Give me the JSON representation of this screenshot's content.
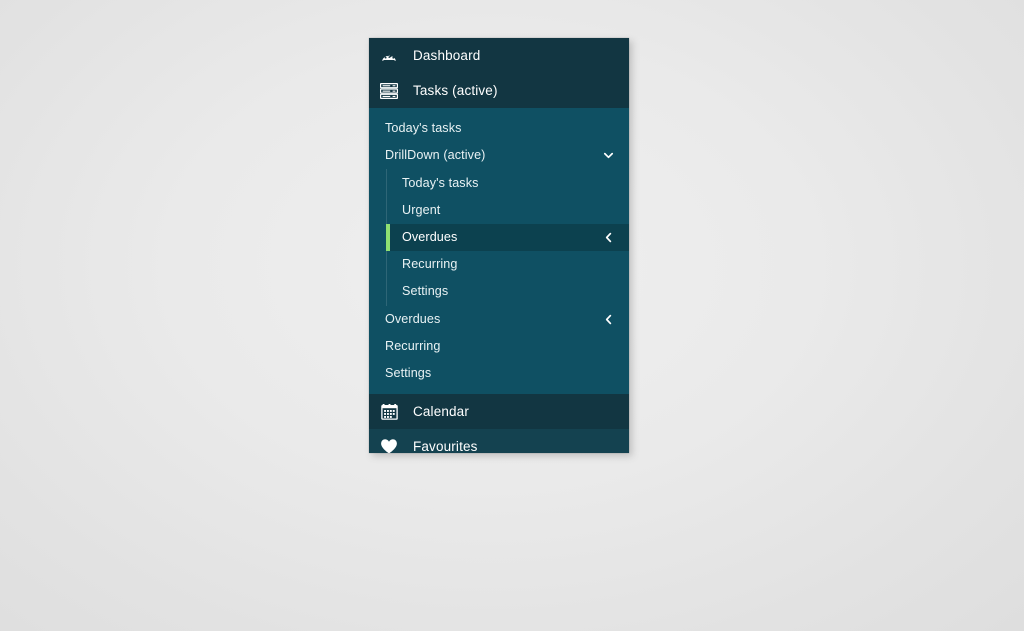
{
  "panel": {
    "top_items": [
      {
        "id": "dashboard",
        "label": "Dashboard",
        "icon": "gauge-icon"
      },
      {
        "id": "tasks",
        "label": "Tasks (active)",
        "icon": "list-stack-icon"
      }
    ],
    "submenu": [
      {
        "id": "todays-tasks",
        "label": "Today's tasks",
        "chevron": ""
      },
      {
        "id": "drilldown",
        "label": "DrillDown (active)",
        "chevron": "chevron-down-icon"
      }
    ],
    "nested": [
      {
        "id": "nested-todays-tasks",
        "label": "Today's tasks",
        "chevron": "",
        "active": false
      },
      {
        "id": "nested-urgent",
        "label": "Urgent",
        "chevron": "",
        "active": false
      },
      {
        "id": "nested-overdues",
        "label": "Overdues",
        "chevron": "chevron-left-icon",
        "active": true
      },
      {
        "id": "nested-recurring",
        "label": "Recurring",
        "chevron": "",
        "active": false
      },
      {
        "id": "nested-settings",
        "label": "Settings",
        "chevron": "",
        "active": false
      }
    ],
    "submenu_tail": [
      {
        "id": "overdues",
        "label": "Overdues",
        "chevron": "chevron-left-icon"
      },
      {
        "id": "recurring",
        "label": "Recurring",
        "chevron": ""
      },
      {
        "id": "settings",
        "label": "Settings",
        "chevron": ""
      }
    ],
    "bottom_items": [
      {
        "id": "calendar",
        "label": "Calendar",
        "icon": "calendar-icon"
      },
      {
        "id": "favourites",
        "label": "Favourites",
        "icon": "heart-icon"
      }
    ],
    "colors": {
      "panel_bg": "#0d4b5c",
      "header_bg": "#123642",
      "submenu_bg": "#0f5063",
      "active_bg": "#0c414f",
      "accent": "#8fe072",
      "text": "#ffffff",
      "sub_text": "#e9f2f4"
    }
  }
}
